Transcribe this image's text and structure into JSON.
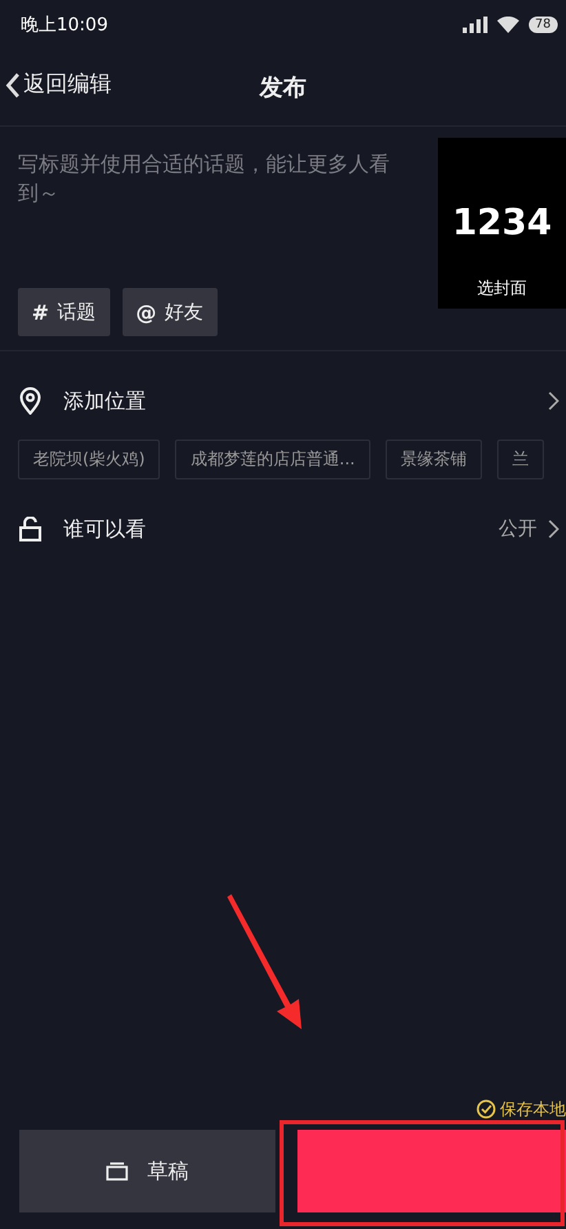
{
  "status_bar": {
    "time": "晚上10:09",
    "battery": "78"
  },
  "header": {
    "back": "返回编辑",
    "title": "发布"
  },
  "caption": {
    "placeholder": "写标题并使用合适的话题，能让更多人看到～"
  },
  "cover": {
    "number": "1234",
    "label": "选封面"
  },
  "tag_buttons": [
    {
      "symbol": "#",
      "label": "话题"
    },
    {
      "symbol": "@",
      "label": "好友"
    }
  ],
  "location": {
    "label": "添加位置",
    "suggestions": [
      "老院坝(柴火鸡)",
      "成都梦莲的店店普通...",
      "景缘茶铺",
      "兰"
    ]
  },
  "privacy": {
    "label": "谁可以看",
    "value": "公开"
  },
  "save_local": {
    "label": "保存本地",
    "checked": true
  },
  "bottom": {
    "draft": "草稿"
  }
}
